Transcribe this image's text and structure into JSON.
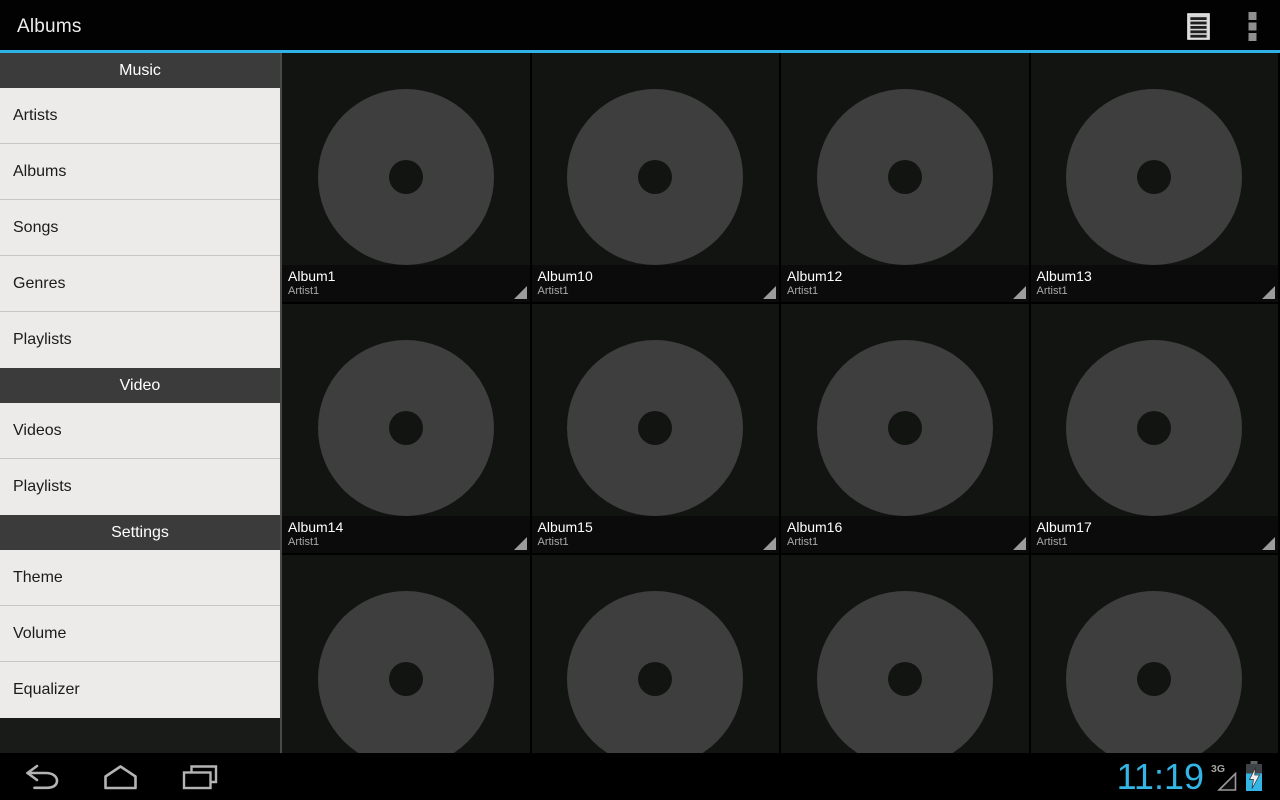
{
  "action_bar": {
    "title": "Albums",
    "icons": [
      "list-view-icon",
      "overflow-menu-icon"
    ]
  },
  "sidebar": {
    "sections": [
      {
        "header": "Music",
        "items": [
          "Artists",
          "Albums",
          "Songs",
          "Genres",
          "Playlists"
        ]
      },
      {
        "header": "Video",
        "items": [
          "Videos",
          "Playlists"
        ]
      },
      {
        "header": "Settings",
        "items": [
          "Theme",
          "Volume",
          "Equalizer"
        ]
      }
    ]
  },
  "album_grid": {
    "tiles": [
      {
        "title": "Album1",
        "artist": "Artist1",
        "label_visible": true
      },
      {
        "title": "Album10",
        "artist": "Artist1",
        "label_visible": true
      },
      {
        "title": "Album12",
        "artist": "Artist1",
        "label_visible": true
      },
      {
        "title": "Album13",
        "artist": "Artist1",
        "label_visible": true
      },
      {
        "title": "Album14",
        "artist": "Artist1",
        "label_visible": true
      },
      {
        "title": "Album15",
        "artist": "Artist1",
        "label_visible": true
      },
      {
        "title": "Album16",
        "artist": "Artist1",
        "label_visible": true
      },
      {
        "title": "Album17",
        "artist": "Artist1",
        "label_visible": true
      },
      {
        "label_visible": false
      },
      {
        "label_visible": false
      },
      {
        "label_visible": false
      },
      {
        "label_visible": false
      }
    ]
  },
  "nav_bar": {
    "clock": "11:19",
    "network_label": "3G",
    "icons": [
      "back-icon",
      "home-icon",
      "recents-icon",
      "signal-triangle-icon",
      "battery-charging-icon"
    ]
  },
  "colors": {
    "accent_blue": "#33B5E5",
    "action_bar_bg": "#020202",
    "sidebar_item_bg": "#EDEAEA",
    "sidebar_header_bg": "#3B3B3B",
    "tile_bg": "#121412",
    "disc_color": "#3E3E3E",
    "label_strip_bg": "#0A0A0A"
  }
}
